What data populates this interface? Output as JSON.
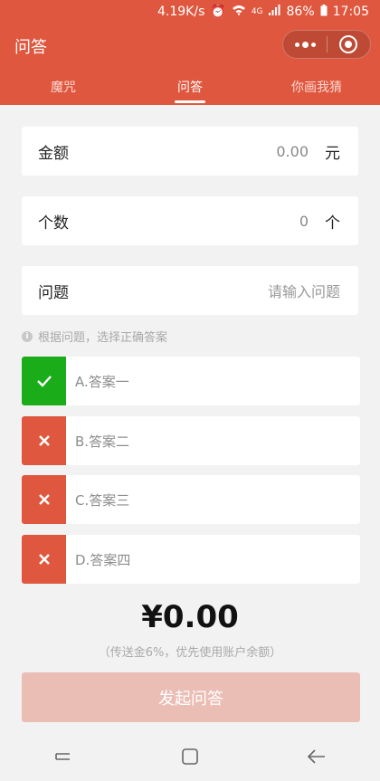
{
  "status_bar": {
    "speed": "4.19K/s",
    "network": "4G",
    "battery": "86%",
    "time": "17:05"
  },
  "title_bar": {
    "title": "问答"
  },
  "tabs": [
    {
      "label": "魔咒",
      "active": false
    },
    {
      "label": "问答",
      "active": true
    },
    {
      "label": "你画我猜",
      "active": false
    }
  ],
  "form": {
    "amount": {
      "label": "金额",
      "value": "0.00",
      "unit": "元"
    },
    "count": {
      "label": "个数",
      "value": "0",
      "unit": "个"
    },
    "question": {
      "label": "问题",
      "placeholder": "请输入问题"
    }
  },
  "hint": "根据问题，选择正确答案",
  "answers": [
    {
      "label": "A.答案一",
      "correct": true
    },
    {
      "label": "B.答案二",
      "correct": false
    },
    {
      "label": "C.答案三",
      "correct": false
    },
    {
      "label": "D.答案四",
      "correct": false
    }
  ],
  "total": "¥0.00",
  "fee_note": "（传送金6%，优先使用账户余额）",
  "submit_label": "发起问答",
  "colors": {
    "brand": "#e0573f",
    "correct": "#1aad19",
    "submit_disabled": "#ebbeb5"
  }
}
